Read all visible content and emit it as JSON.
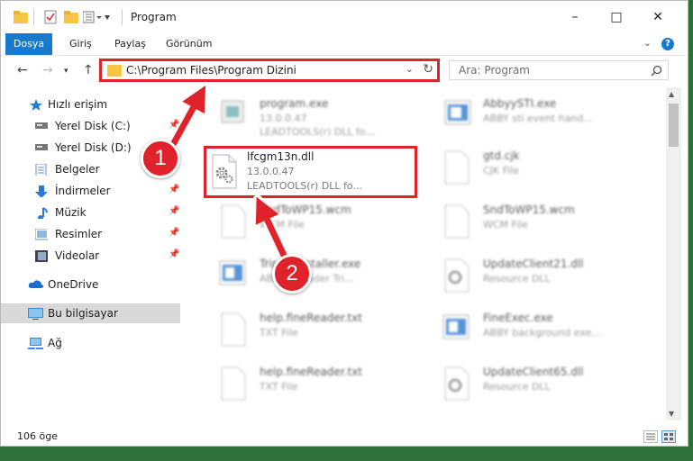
{
  "window": {
    "title": "Program",
    "controls": {
      "minimize": "–",
      "maximize": "□",
      "close": "✕"
    }
  },
  "ribbon": {
    "tabs": [
      "Dosya",
      "Giriş",
      "Paylaş",
      "Görünüm"
    ],
    "help_label": "?",
    "accent": "#1979ca"
  },
  "navigation": {
    "address_path": "C:\\Program Files\\Program Dizini",
    "search_placeholder": "Ara: Program"
  },
  "sidebar": {
    "items": [
      {
        "label": "Hızlı erişim",
        "icon": "star-icon",
        "pinned": false
      },
      {
        "label": "Yerel Disk (C:)",
        "icon": "drive-icon",
        "pinned": true
      },
      {
        "label": "Yerel Disk (D:)",
        "icon": "drive-icon",
        "pinned": true
      },
      {
        "label": "Belgeler",
        "icon": "documents-icon",
        "pinned": true
      },
      {
        "label": "İndirmeler",
        "icon": "download-icon",
        "pinned": true
      },
      {
        "label": "Müzik",
        "icon": "music-icon",
        "pinned": true
      },
      {
        "label": "Resimler",
        "icon": "pictures-icon",
        "pinned": true
      },
      {
        "label": "Videolar",
        "icon": "videos-icon",
        "pinned": true
      },
      {
        "label": "OneDrive",
        "icon": "cloud-icon",
        "pinned": false
      },
      {
        "label": "Bu bilgisayar",
        "icon": "computer-icon",
        "pinned": false,
        "selected": true
      },
      {
        "label": "Ağ",
        "icon": "network-icon",
        "pinned": false
      }
    ]
  },
  "files": [
    {
      "name": "program.exe",
      "line2": "13.0.0.47",
      "line3": "LEADTOOLS(r) DLL fo...",
      "icon": "exe-icon"
    },
    {
      "name": "AbbyySTI.exe",
      "line2": "ABBY sti event hand...",
      "line3": "",
      "icon": "exe-icon"
    },
    {
      "name": "lfcgm13n.dll",
      "line2": "13.0.0.47",
      "line3": "LEADTOOLS(r) DLL fo...",
      "icon": "dll-gear-icon",
      "highlighted": true
    },
    {
      "name": "gtd.cjk",
      "line2": "CJK File",
      "line3": "",
      "icon": "file-icon"
    },
    {
      "name": "SndToWP15.wcm",
      "line2": "WCM File",
      "line3": "",
      "icon": "file-icon"
    },
    {
      "name": "SndToWP15.wcm",
      "line2": "WCM File",
      "line3": "",
      "icon": "file-icon"
    },
    {
      "name": "TrippleInstaller.exe",
      "line2": "ABBYY Reader Tri...",
      "line3": "",
      "icon": "exe-icon"
    },
    {
      "name": "UpdateClient21.dll",
      "line2": "Resource DLL",
      "line3": "",
      "icon": "dll-gear-icon"
    },
    {
      "name": "help.fineReader.txt",
      "line2": "TXT File",
      "line3": "",
      "icon": "file-icon"
    },
    {
      "name": "FineExec.exe",
      "line2": "ABBY background exe...",
      "line3": "",
      "icon": "exe-icon"
    },
    {
      "name": "help.fineReader.txt",
      "line2": "TXT File",
      "line3": "",
      "icon": "file-icon"
    },
    {
      "name": "UpdateClient65.dll",
      "line2": "Resource DLL",
      "line3": "",
      "icon": "dll-gear-icon"
    }
  ],
  "status": {
    "item_count": "106 öge"
  },
  "callouts": {
    "one": "1",
    "two": "2",
    "color": "#e0232b"
  }
}
